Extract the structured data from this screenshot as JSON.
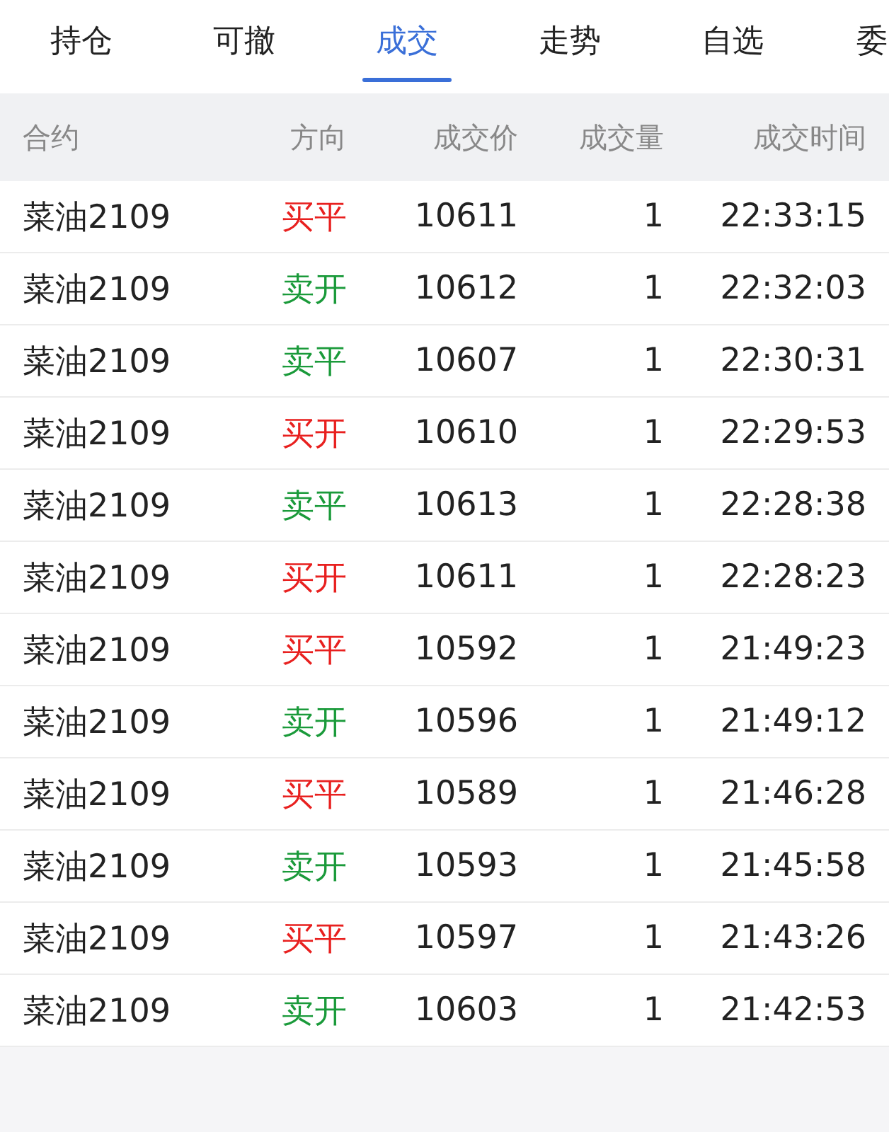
{
  "tabs": [
    {
      "label": "持仓",
      "selected": false
    },
    {
      "label": "可撤",
      "selected": false
    },
    {
      "label": "成交",
      "selected": true
    },
    {
      "label": "走势",
      "selected": false
    },
    {
      "label": "自选",
      "selected": false
    },
    {
      "label": "委",
      "selected": false
    }
  ],
  "table": {
    "columns": [
      "合约",
      "方向",
      "成交价",
      "成交量",
      "成交时间"
    ],
    "rows": [
      {
        "contract": "菜油2109",
        "direction": "买平",
        "color": "#e8201f",
        "price": "10611",
        "volume": "1",
        "time": "22:33:15"
      },
      {
        "contract": "菜油2109",
        "direction": "卖开",
        "color": "#1a9a3a",
        "price": "10612",
        "volume": "1",
        "time": "22:32:03"
      },
      {
        "contract": "菜油2109",
        "direction": "卖平",
        "color": "#1a9a3a",
        "price": "10607",
        "volume": "1",
        "time": "22:30:31"
      },
      {
        "contract": "菜油2109",
        "direction": "买开",
        "color": "#e8201f",
        "price": "10610",
        "volume": "1",
        "time": "22:29:53"
      },
      {
        "contract": "菜油2109",
        "direction": "卖平",
        "color": "#1a9a3a",
        "price": "10613",
        "volume": "1",
        "time": "22:28:38"
      },
      {
        "contract": "菜油2109",
        "direction": "买开",
        "color": "#e8201f",
        "price": "10611",
        "volume": "1",
        "time": "22:28:23"
      },
      {
        "contract": "菜油2109",
        "direction": "买平",
        "color": "#e8201f",
        "price": "10592",
        "volume": "1",
        "time": "21:49:23"
      },
      {
        "contract": "菜油2109",
        "direction": "卖开",
        "color": "#1a9a3a",
        "price": "10596",
        "volume": "1",
        "time": "21:49:12"
      },
      {
        "contract": "菜油2109",
        "direction": "买平",
        "color": "#e8201f",
        "price": "10589",
        "volume": "1",
        "time": "21:46:28"
      },
      {
        "contract": "菜油2109",
        "direction": "卖开",
        "color": "#1a9a3a",
        "price": "10593",
        "volume": "1",
        "time": "21:45:58"
      },
      {
        "contract": "菜油2109",
        "direction": "买平",
        "color": "#e8201f",
        "price": "10597",
        "volume": "1",
        "time": "21:43:26"
      },
      {
        "contract": "菜油2109",
        "direction": "卖开",
        "color": "#1a9a3a",
        "price": "10603",
        "volume": "1",
        "time": "21:42:53"
      }
    ]
  }
}
